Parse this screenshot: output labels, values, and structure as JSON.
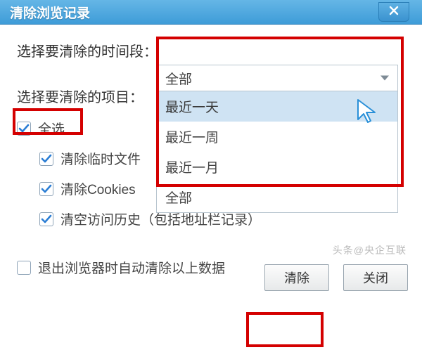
{
  "title": "清除浏览记录",
  "labels": {
    "time_range": "选择要清除的时间段：",
    "items": "选择要清除的项目："
  },
  "combo": {
    "selected": "全部",
    "options": [
      "最近一天",
      "最近一周",
      "最近一月",
      "全部"
    ],
    "highlight_index": 0
  },
  "checkboxes": {
    "select_all": {
      "label": "全选",
      "checked": true
    },
    "temp_files": {
      "label": "清除临时文件",
      "checked": true
    },
    "cookies": {
      "label": "清除Cookies",
      "checked": true
    },
    "history": {
      "label": "清空访问历史（包括地址栏记录）",
      "checked": true
    },
    "auto_clear": {
      "label": "退出浏览器时自动清除以上数据",
      "checked": false
    }
  },
  "buttons": {
    "clear": "清除",
    "close": "关闭"
  },
  "watermark": "头条@央企互联",
  "colors": {
    "highlight": "#d40000",
    "titlebar_top": "#65b6e6",
    "titlebar_bottom": "#3e9cd8",
    "dropdown_highlight": "#cfe3f3"
  }
}
